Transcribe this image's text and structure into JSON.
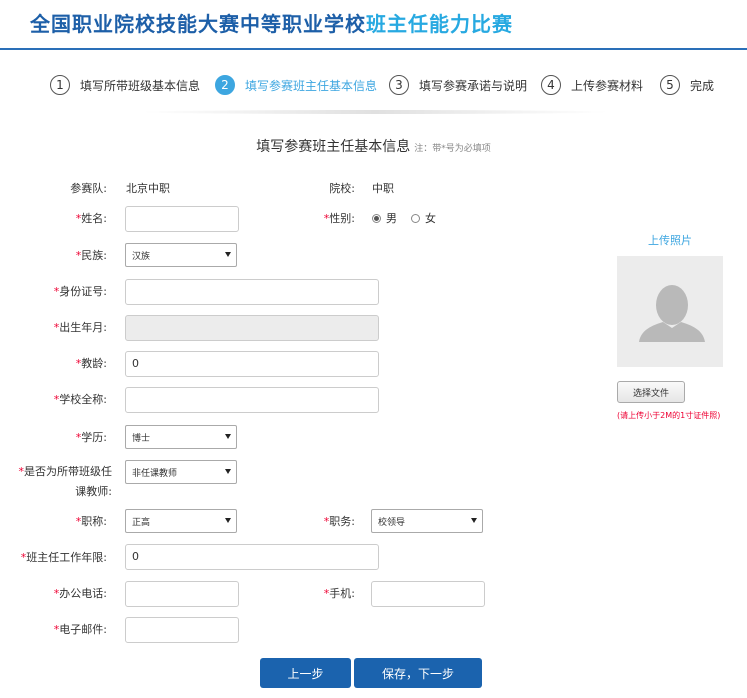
{
  "header": {
    "title_main": "全国职业院校技能大赛中等职业学校",
    "title_accent": "班主任能力比赛"
  },
  "steps": [
    {
      "num": "1",
      "label": "填写所带班级基本信息"
    },
    {
      "num": "2",
      "label": "填写参赛班主任基本信息"
    },
    {
      "num": "3",
      "label": "填写参赛承诺与说明"
    },
    {
      "num": "4",
      "label": "上传参赛材料"
    },
    {
      "num": "5",
      "label": "完成"
    }
  ],
  "form": {
    "title": "填写参赛班主任基本信息",
    "note": "注：带*号为必填项",
    "team_label": "参赛队:",
    "team_value": "北京中职",
    "school_label": "院校:",
    "school_value": "中职",
    "name_label": "姓名:",
    "name_value": "",
    "gender_label": "性别:",
    "gender_options": [
      "男",
      "女"
    ],
    "ethnicity_label": "民族:",
    "ethnicity_value": "汉族",
    "id_label": "身份证号:",
    "id_value": "",
    "birth_label": "出生年月:",
    "birth_value": "",
    "teach_years_label": "教龄:",
    "teach_years_value": "0",
    "school_full_label": "学校全称:",
    "school_full_value": "",
    "education_label": "学历:",
    "education_value": "博士",
    "is_teacher_label_1": "是否为所带班级任",
    "is_teacher_label_2": "课教师:",
    "is_teacher_value": "非任课教师",
    "title_rank_label": "职称:",
    "title_rank_value": "正高",
    "position_label": "职务:",
    "position_value": "校领导",
    "ht_years_label": "班主任工作年限:",
    "ht_years_value": "0",
    "office_phone_label": "办公电话:",
    "office_phone_value": "",
    "mobile_label": "手机:",
    "mobile_value": "",
    "email_label": "电子邮件:",
    "email_value": ""
  },
  "photo": {
    "upload_link": "上传照片",
    "choose_file": "选择文件",
    "hint": "(请上传小于2M的1寸证件照)"
  },
  "buttons": {
    "prev": "上一步",
    "save_next": "保存，下一步"
  },
  "colors": {
    "brand": "#1d5fa8",
    "accent": "#27a9e1",
    "required": "#ee0033",
    "button": "#1b63ae"
  }
}
